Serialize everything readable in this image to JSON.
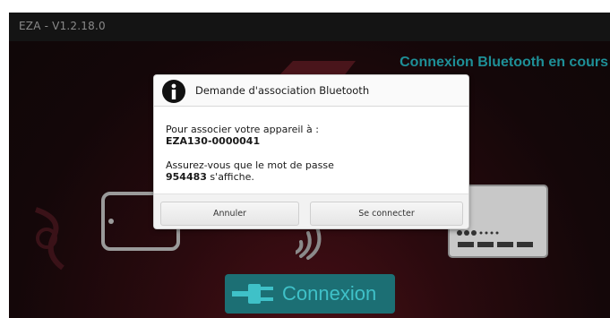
{
  "app": {
    "title": "EZA - V1.2.18.0"
  },
  "status": {
    "text": "Connexion Bluetooth en cours"
  },
  "main": {
    "connect_label": "Connexion"
  },
  "dialog": {
    "title": "Demande d'association Bluetooth",
    "line1": "Pour associer votre appareil à :",
    "device_name": "EZA130-0000041",
    "line2": "Assurez-vous que le mot de passe",
    "passkey": "954483",
    "line3_suffix": " s'affiche.",
    "cancel_label": "Annuler",
    "connect_label": "Se connecter"
  },
  "colors": {
    "accent": "#1e8f97",
    "button_bg": "#1c6f74",
    "background_red": "#4a0f16"
  },
  "icons": [
    "info-icon",
    "plug-icon",
    "tablet-icon",
    "card-reader-icon",
    "wireless-signal-icon",
    "logo-mark"
  ]
}
